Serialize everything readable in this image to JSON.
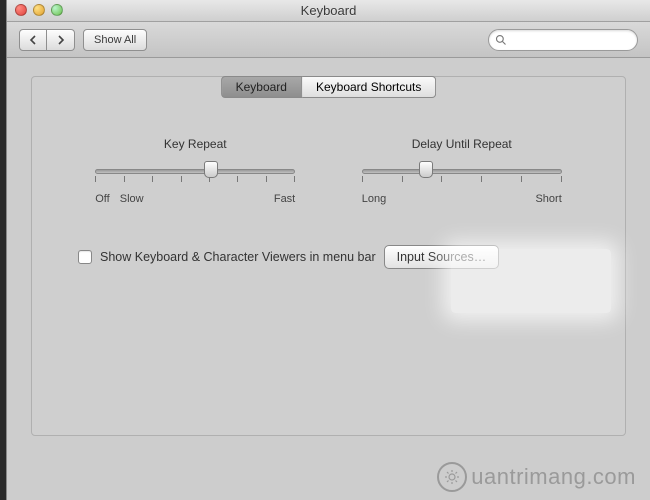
{
  "window": {
    "title": "Keyboard"
  },
  "toolbar": {
    "showAll": "Show All",
    "searchPlaceholder": ""
  },
  "tabs": {
    "keyboard": "Keyboard",
    "shortcuts": "Keyboard Shortcuts"
  },
  "sliders": {
    "keyRepeat": {
      "label": "Key Repeat",
      "leftA": "Off",
      "leftB": "Slow",
      "right": "Fast",
      "ticks": 8,
      "position": 0.58
    },
    "delay": {
      "label": "Delay Until Repeat",
      "left": "Long",
      "right": "Short",
      "ticks": 6,
      "position": 0.32
    }
  },
  "checkbox": {
    "label": "Show Keyboard & Character Viewers in menu bar",
    "checked": false
  },
  "button": {
    "inputSources": "Input Sources…"
  },
  "watermark": "uantrimang.com"
}
